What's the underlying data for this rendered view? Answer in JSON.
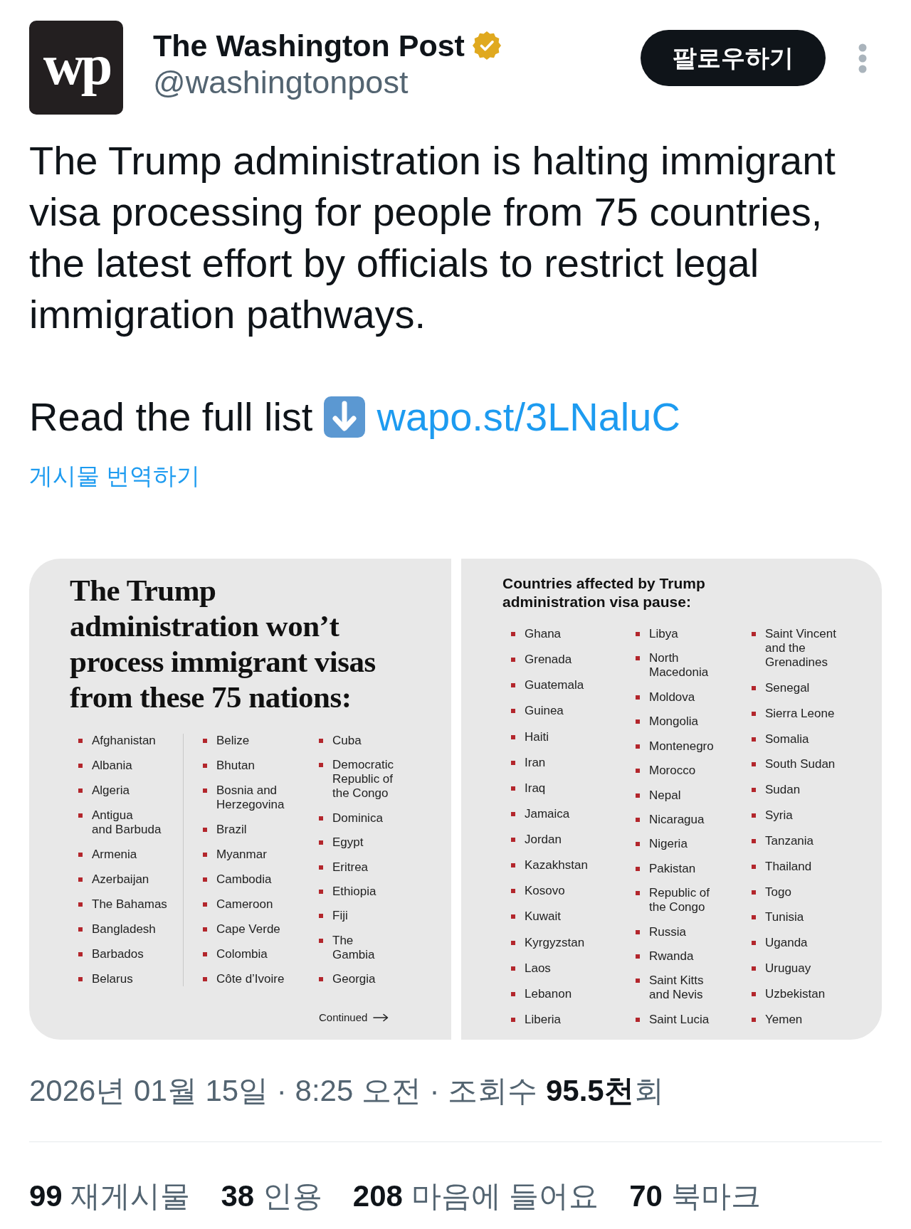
{
  "author": {
    "logo": "wp",
    "name": "The Washington Post",
    "verified": true,
    "handle": "@washingtonpost"
  },
  "follow_button": "팔로우하기",
  "tweet": {
    "text": "The Trump administration is halting immigrant visa processing for people from 75 countries, the latest effort by officials to restrict legal immigration pathways.",
    "read_more": "Read the full list",
    "link": "wapo.st/3LNaluC"
  },
  "translate_link": "게시물 번역하기",
  "media": {
    "panels": [
      {
        "kind": "cover",
        "heading": "The Trump administration won’t process immigrant visas from these 75 nations:",
        "columns": [
          {
            "items": [
              "Afghanistan",
              "Albania",
              "Algeria",
              "Antigua\nand Barbuda",
              "Armenia",
              "Azerbaijan",
              "The Bahamas",
              "Bangladesh",
              "Barbados",
              "Belarus"
            ]
          },
          {
            "items": [
              "Belize",
              "Bhutan",
              "Bosnia and\nHerzegovina",
              "Brazil",
              "Myanmar",
              "Cambodia",
              "Cameroon",
              "Cape Verde",
              "Colombia",
              "Côte d’Ivoire"
            ]
          },
          {
            "items": [
              "Cuba",
              "Democratic\nRepublic of\nthe Congo",
              "Dominica",
              "Egypt",
              "Eritrea",
              "Ethiopia",
              "Fiji",
              "The\nGambia",
              "Georgia"
            ]
          }
        ],
        "continued": "Continued"
      },
      {
        "kind": "list",
        "heading": "Countries affected by Trump administration visa pause:",
        "columns": [
          {
            "items": [
              "Ghana",
              "Grenada",
              "Guatemala",
              "Guinea",
              "Haiti",
              "Iran",
              "Iraq",
              "Jamaica",
              "Jordan",
              "Kazakhstan",
              "Kosovo",
              "Kuwait",
              "Kyrgyzstan",
              "Laos",
              "Lebanon",
              "Liberia"
            ]
          },
          {
            "items": [
              "Libya",
              "North\nMacedonia",
              "Moldova",
              "Mongolia",
              "Montenegro",
              "Morocco",
              "Nepal",
              "Nicaragua",
              "Nigeria",
              "Pakistan",
              "Republic of\nthe Congo",
              "Russia",
              "Rwanda",
              "Saint Kitts\nand Nevis",
              "Saint Lucia"
            ]
          },
          {
            "items": [
              "Saint Vincent\nand the\nGrenadines",
              "Senegal",
              "Sierra Leone",
              "Somalia",
              "South Sudan",
              "Sudan",
              "Syria",
              "Tanzania",
              "Thailand",
              "Togo",
              "Tunisia",
              "Uganda",
              "Uruguay",
              "Uzbekistan",
              "Yemen"
            ]
          }
        ]
      }
    ]
  },
  "timestamp": "2026년 01월 15일 · 8:25 오전 · 조회수 **95.5천**회",
  "stats": [
    {
      "count": "99",
      "label": "재게시물"
    },
    {
      "count": "38",
      "label": "인용"
    },
    {
      "count": "208",
      "label": "마음에 들어요"
    },
    {
      "count": "70",
      "label": "북마크"
    }
  ]
}
